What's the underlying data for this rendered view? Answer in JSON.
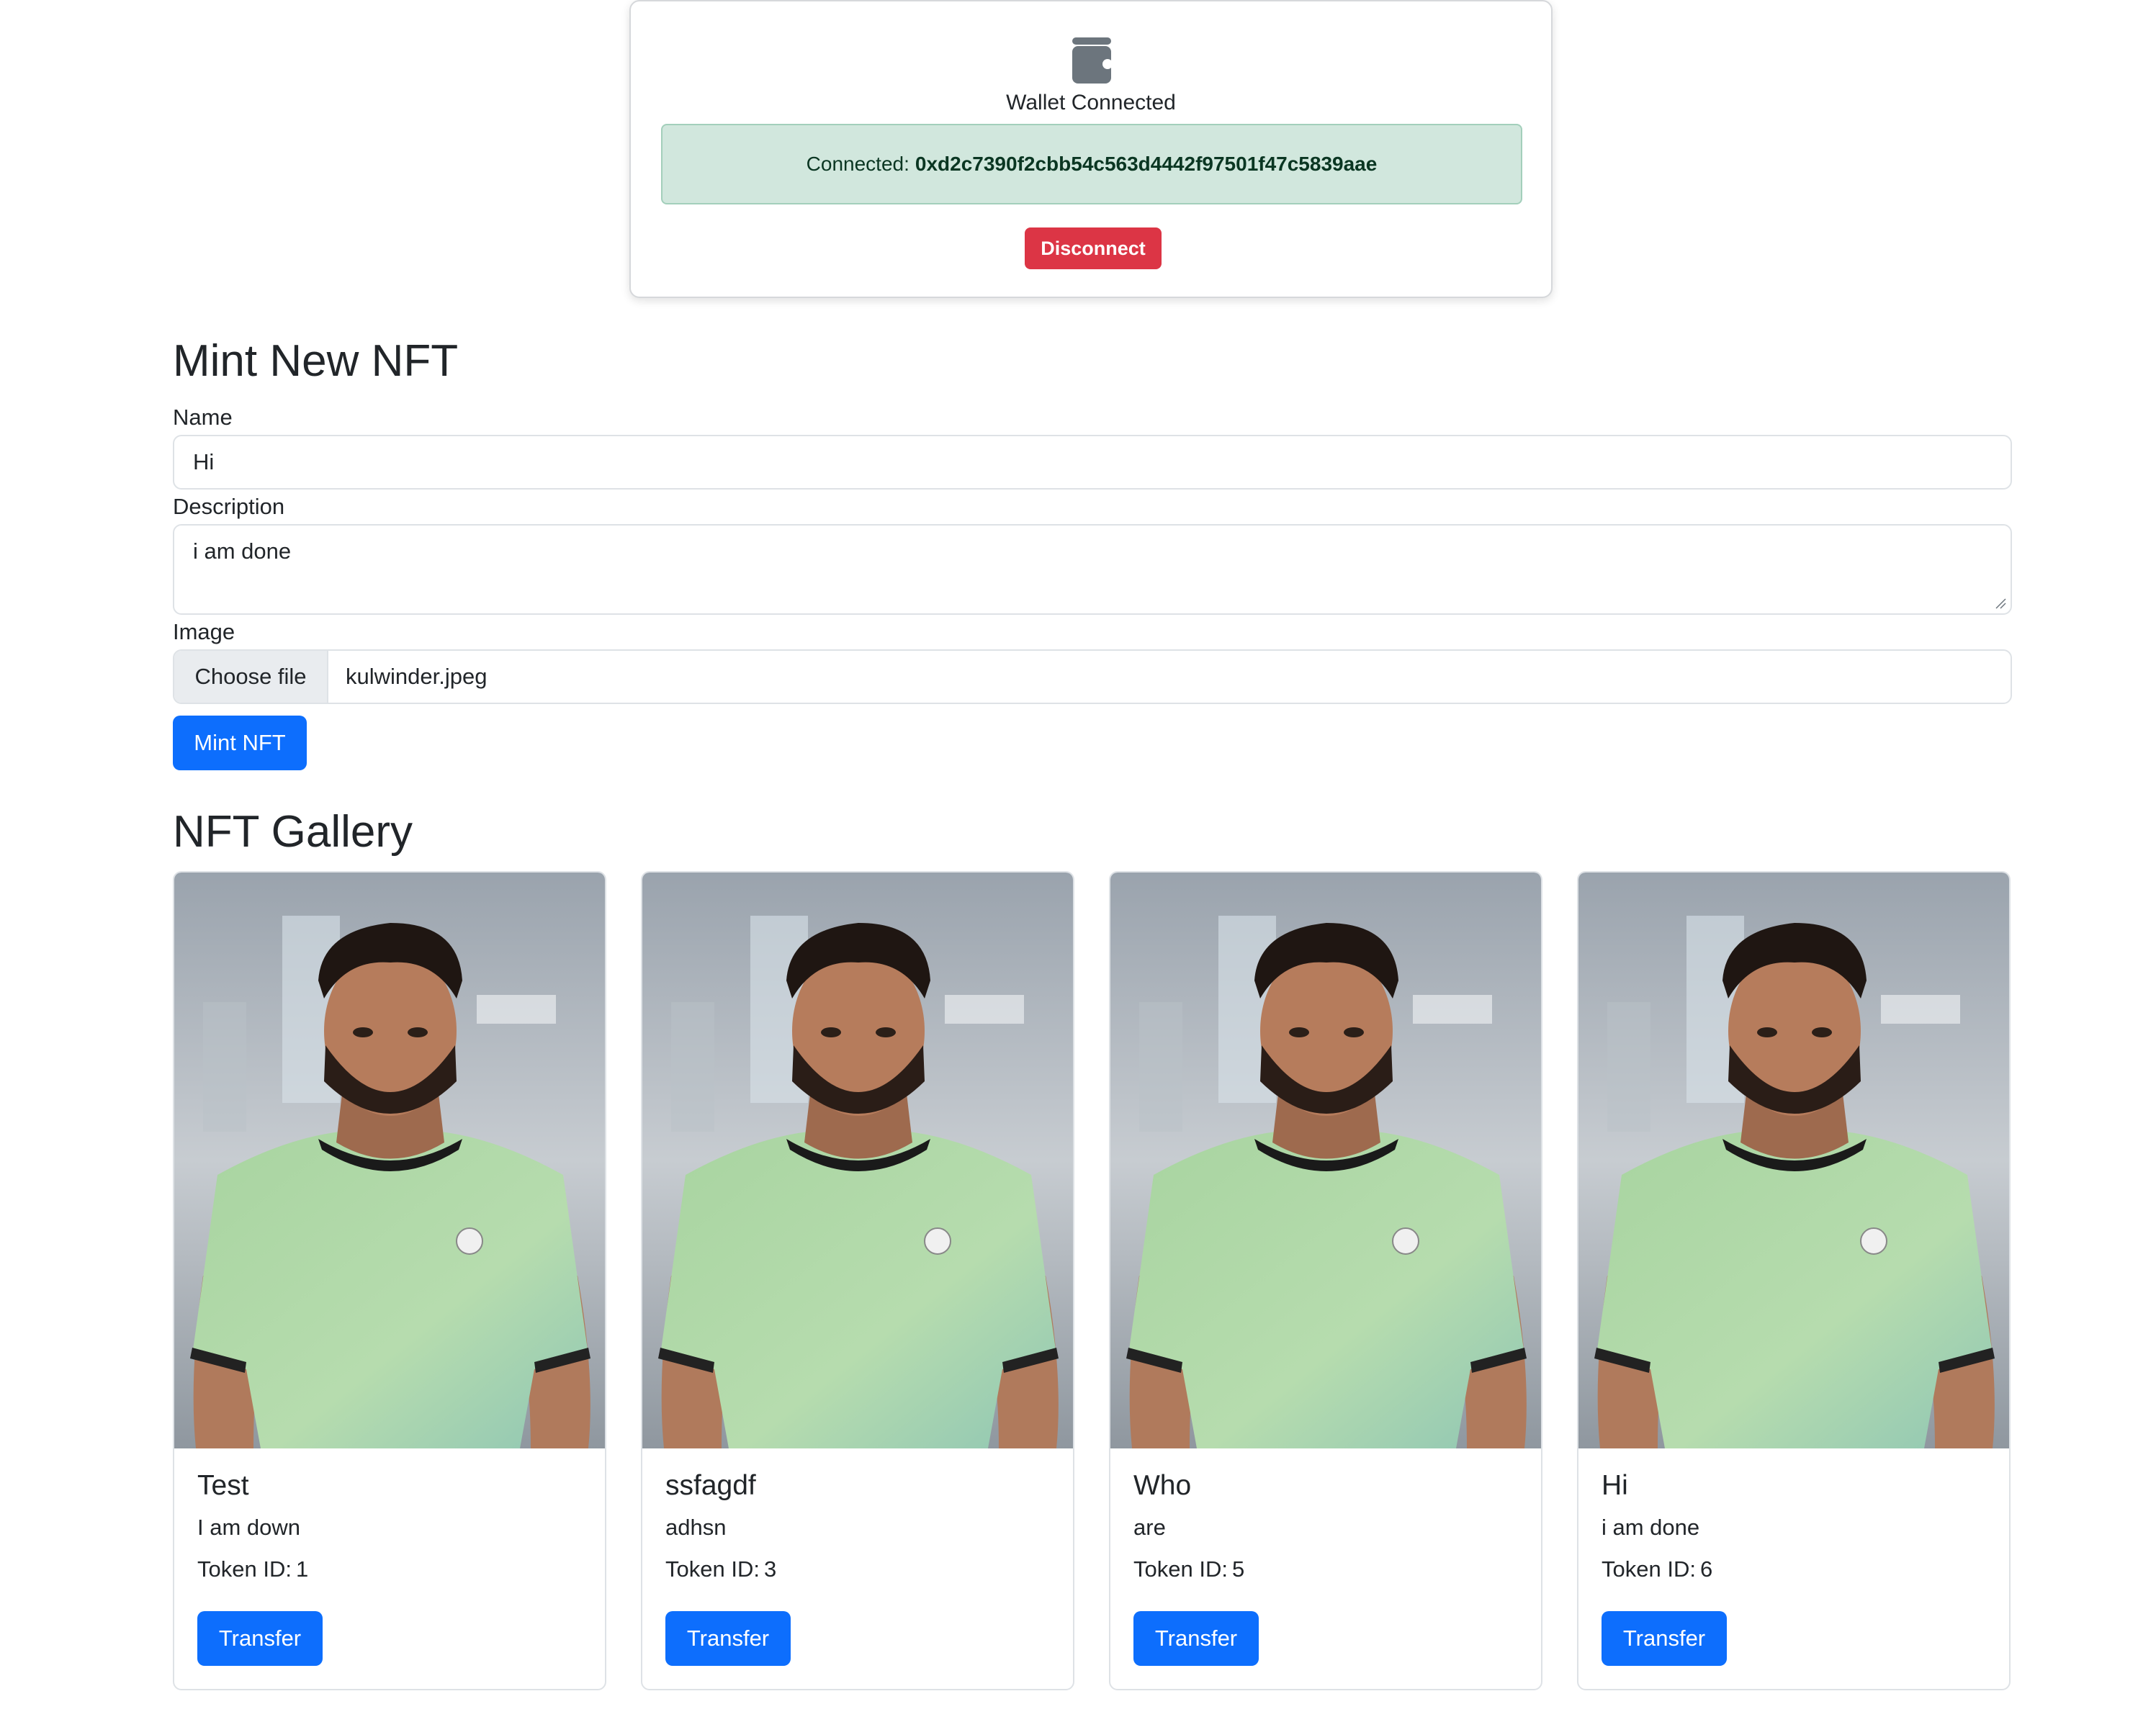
{
  "wallet": {
    "icon": "wallet-icon",
    "title": "Wallet Connected",
    "connected_label": "Connected:",
    "address": "0xd2c7390f2cbb54c563d4442f97501f47c5839aae",
    "disconnect_label": "Disconnect"
  },
  "mint": {
    "heading": "Mint New NFT",
    "name_label": "Name",
    "name_value": "Hi",
    "description_label": "Description",
    "description_value": "i am done",
    "image_label": "Image",
    "choose_file_label": "Choose file",
    "file_name": "kulwinder.jpeg",
    "mint_button": "Mint NFT"
  },
  "gallery": {
    "heading": "NFT Gallery",
    "token_label": "Token ID:",
    "transfer_label": "Transfer",
    "cards": [
      {
        "title": "Test",
        "description": "I am down",
        "token_id": "1"
      },
      {
        "title": "ssfagdf",
        "description": "adhsn",
        "token_id": "3"
      },
      {
        "title": "Who",
        "description": "are",
        "token_id": "5"
      },
      {
        "title": "Hi",
        "description": "i am done",
        "token_id": "6"
      }
    ]
  },
  "colors": {
    "primary": "#0d6efd",
    "danger": "#dc3545",
    "success_bg": "#d1e7dd",
    "success_text": "#0a3622"
  }
}
